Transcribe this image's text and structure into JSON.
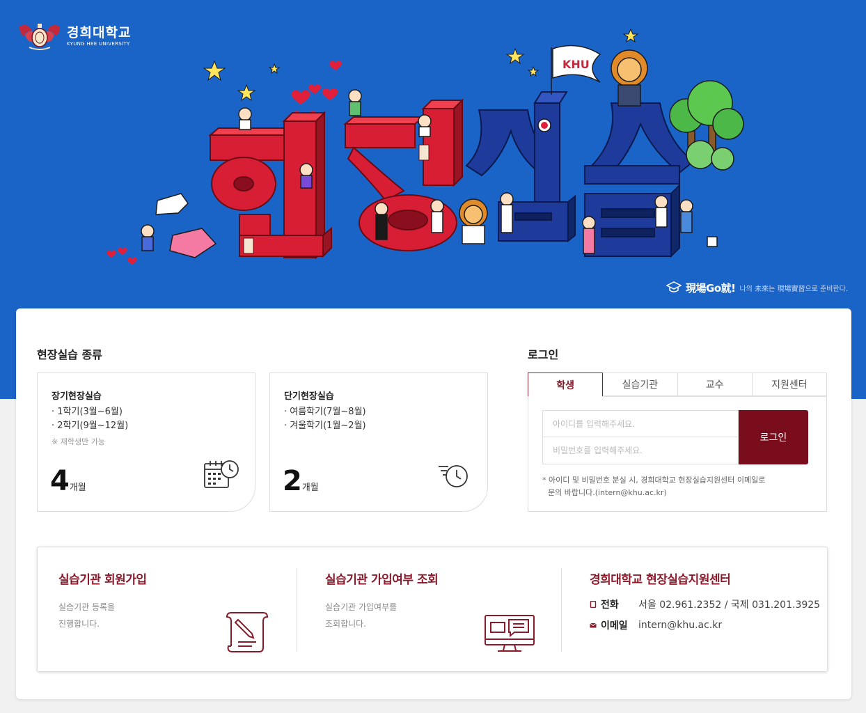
{
  "header": {
    "university_ko": "경희대학교",
    "university_en": "KYUNG HEE UNIVERSITY",
    "slogan_main": "現場Go就!",
    "slogan_sub": "나의 未來는 現場實習으로 준비한다."
  },
  "practice_types": {
    "title": "현장실습 종류",
    "long_term": {
      "title": "장기현장실습",
      "items": [
        "· 1학기(3월~6월)",
        "· 2학기(9월~12월)"
      ],
      "note": "※ 재학생만 가능",
      "duration_number": "4",
      "duration_unit": "개월",
      "icon": "calendar-clock-icon"
    },
    "short_term": {
      "title": "단기현장실습",
      "items": [
        "· 여름학기(7월~8월)",
        "· 겨울학기(1월~2월)"
      ],
      "duration_number": "2",
      "duration_unit": "개월",
      "icon": "fast-clock-icon"
    }
  },
  "login": {
    "title": "로그인",
    "tabs": [
      {
        "label": "학생",
        "active": true
      },
      {
        "label": "실습기관",
        "active": false
      },
      {
        "label": "교수",
        "active": false
      },
      {
        "label": "지원센터",
        "active": false
      }
    ],
    "id_placeholder": "아이디를 입력해주세요.",
    "password_placeholder": "비밀번호를 입력해주세요.",
    "button_label": "로그인",
    "note_line1": "* 아이디 및 비밀번호 분실 시, 경희대학교 현장실습지원센터 이메일로",
    "note_line2": "문의 바랍니다.(intern@khu.ac.kr)"
  },
  "bottom": {
    "signup": {
      "title": "실습기관 회원가입",
      "desc_line1": "실습기관 등록을",
      "desc_line2": "진행합니다.",
      "icon": "pen-document-icon"
    },
    "lookup": {
      "title": "실습기관 가입여부 조회",
      "desc_line1": "실습기관 가입여부를",
      "desc_line2": "조회합니다.",
      "icon": "monitor-chat-icon"
    },
    "center": {
      "title": "경희대학교 현장실습지원센터",
      "phone_label": "전화",
      "phone_value": "서울 02.961.2352 / 국제 031.201.3925",
      "email_label": "이메일",
      "email_value": "intern@khu.ac.kr"
    }
  },
  "colors": {
    "hero_blue": "#1a64c8",
    "accent_crimson": "#7a0d1c",
    "page_bg": "#f1f1f1"
  }
}
